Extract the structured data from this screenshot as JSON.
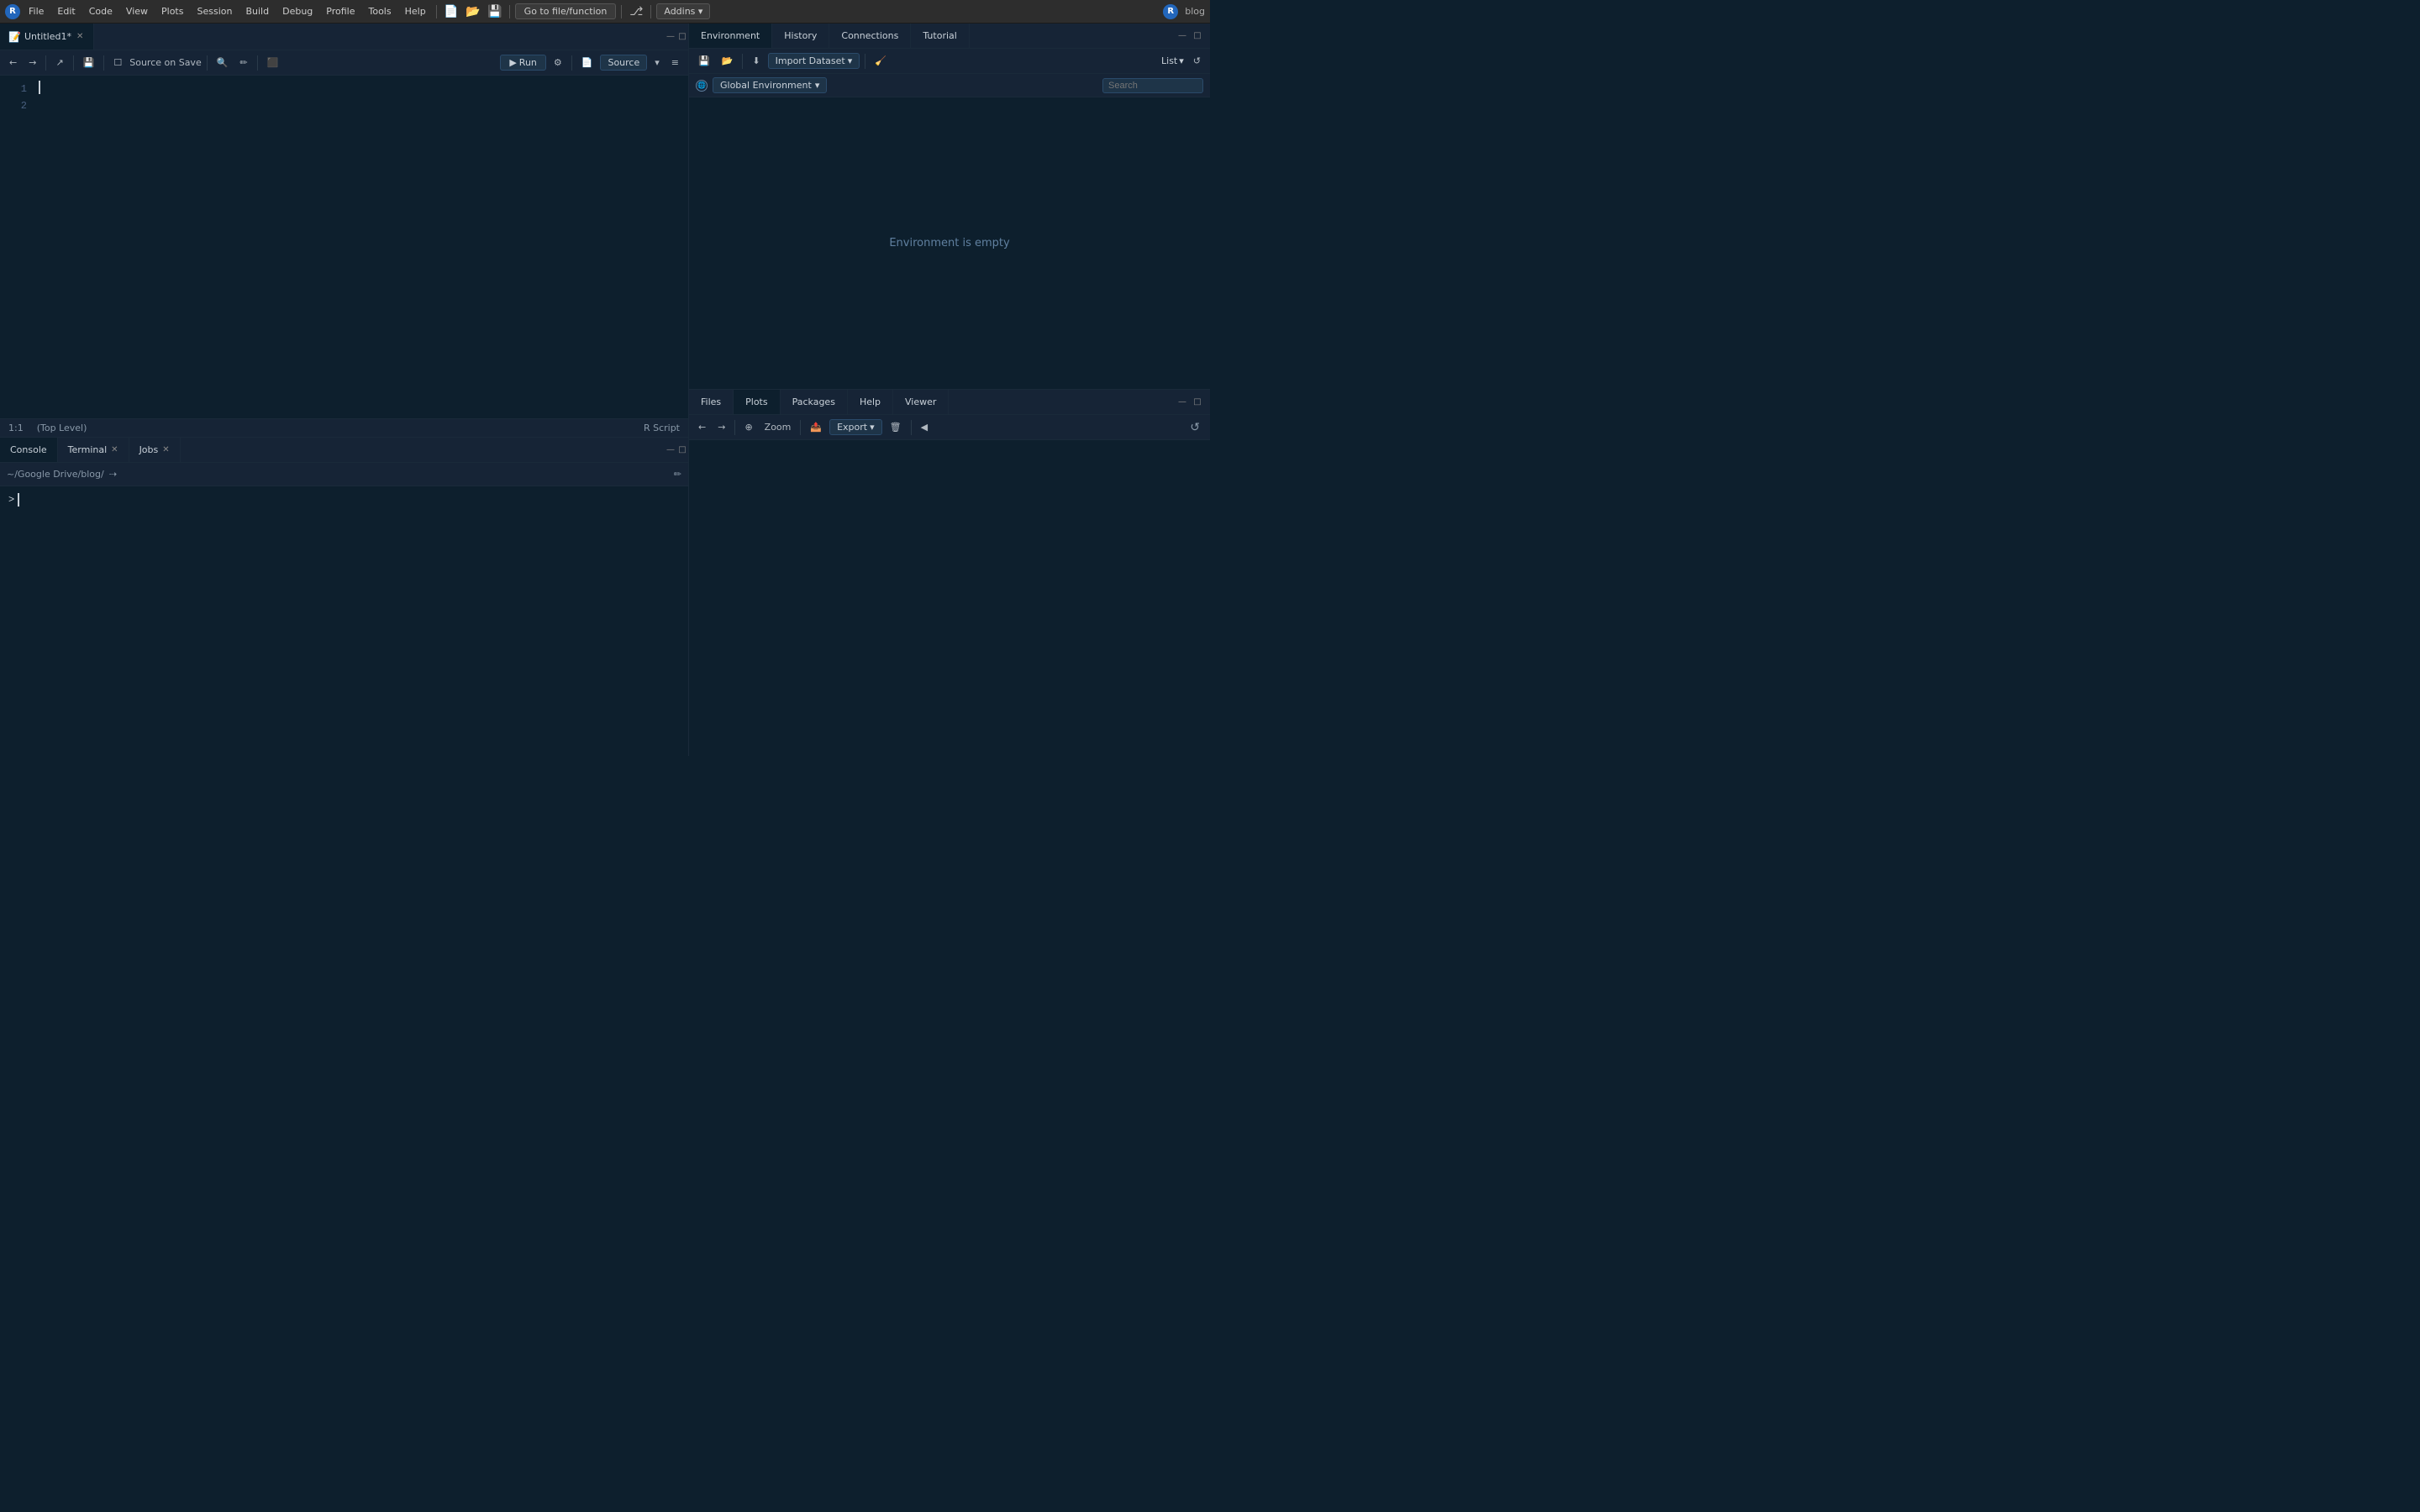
{
  "menubar": {
    "items": [
      "File",
      "Edit",
      "Code",
      "View",
      "Plots",
      "Session",
      "Build",
      "Debug",
      "Profile",
      "Tools",
      "Help"
    ],
    "go_to_label": "Go to file/function",
    "addins_label": "Addins",
    "blog_label": "blog"
  },
  "editor": {
    "tab_name": "Untitled1*",
    "tab_icon": "📄",
    "toolbar": {
      "source_on_save": "Source on Save",
      "run_label": "Run",
      "source_label": "Source"
    },
    "line_numbers": [
      "1",
      "2"
    ],
    "status": {
      "position": "1:1",
      "level": "(Top Level)",
      "type": "R Script"
    }
  },
  "console": {
    "tabs": [
      {
        "label": "Console",
        "active": true,
        "closable": false
      },
      {
        "label": "Terminal",
        "active": false,
        "closable": true
      },
      {
        "label": "Jobs",
        "active": false,
        "closable": true
      }
    ],
    "path": "~/Google Drive/blog/",
    "prompt": ">"
  },
  "environment": {
    "tabs": [
      {
        "label": "Environment",
        "active": true
      },
      {
        "label": "History",
        "active": false
      },
      {
        "label": "Connections",
        "active": false
      },
      {
        "label": "Tutorial",
        "active": false
      }
    ],
    "toolbar": {
      "import_label": "Import Dataset",
      "list_label": "List"
    },
    "global_env_label": "Global Environment",
    "empty_message": "Environment is empty"
  },
  "plots": {
    "tabs": [
      {
        "label": "Files",
        "active": false
      },
      {
        "label": "Plots",
        "active": true
      },
      {
        "label": "Packages",
        "active": false
      },
      {
        "label": "Help",
        "active": false
      },
      {
        "label": "Viewer",
        "active": false
      }
    ],
    "toolbar": {
      "zoom_label": "Zoom",
      "export_label": "Export"
    }
  }
}
